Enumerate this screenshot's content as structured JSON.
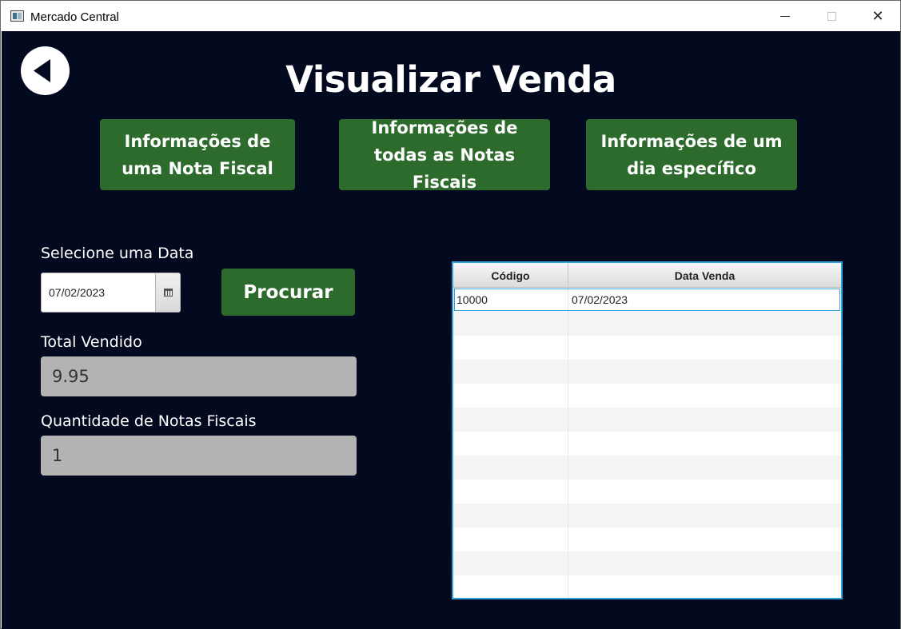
{
  "window": {
    "title": "Mercado Central",
    "controls": {
      "minimize": "—",
      "maximize": "☐",
      "close": "✕"
    }
  },
  "header": {
    "back_icon": "back-arrow-icon",
    "title": "Visualizar Venda"
  },
  "nav": {
    "nota_fiscal": "Informações de uma Nota Fiscal",
    "todas_notas": "Informações de todas as Notas Fiscais",
    "dia_especifico": "Informações de um dia específico"
  },
  "form": {
    "date_label": "Selecione uma Data",
    "date_value": "07/02/2023",
    "calendar_icon": "calendar-icon",
    "search_label": "Procurar",
    "total_label": "Total Vendido",
    "total_value": "9.95",
    "qtd_label": "Quantidade de Notas Fiscais",
    "qtd_value": "1"
  },
  "table": {
    "columns": [
      "Código",
      "Data Venda"
    ],
    "rows": [
      [
        "10000",
        "07/02/2023"
      ]
    ]
  },
  "colors": {
    "background": "#030a1f",
    "button": "#2d6b2d",
    "field": "#b3b3b3",
    "table_focus": "#2ea2d9"
  }
}
